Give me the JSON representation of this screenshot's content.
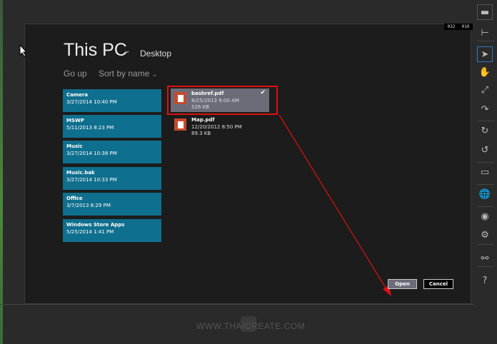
{
  "header": {
    "title": "This PC",
    "location": "Desktop",
    "go_up": "Go up",
    "sort": "Sort by name"
  },
  "counter": [
    "032",
    "010"
  ],
  "folders": [
    {
      "name": "Camera",
      "date": "3/27/2014 10:40 PM"
    },
    {
      "name": "MSWP",
      "date": "5/11/2013 8:23 PM"
    },
    {
      "name": "Music",
      "date": "3/27/2014 10:38 PM"
    },
    {
      "name": "Music.bak",
      "date": "3/27/2014 10:33 PM"
    },
    {
      "name": "Office",
      "date": "3/7/2013 8:29 PM"
    },
    {
      "name": "Windows Store Apps",
      "date": "5/25/2014 1:41 PM"
    }
  ],
  "files": [
    {
      "name": "bashref.pdf",
      "date": "8/25/2013 9:00 AM",
      "size": "526 KB",
      "selected": true
    },
    {
      "name": "Map.pdf",
      "date": "12/20/2012 8:50 PM",
      "size": "89.3 KB",
      "selected": false
    }
  ],
  "buttons": {
    "open": "Open",
    "cancel": "Cancel"
  },
  "toolbar": [
    "minimize-icon",
    "pin-icon",
    "pointer-icon",
    "hand-icon",
    "pinch-icon",
    "rotate-gesture-icon",
    "rotate-right-icon",
    "rotate-left-icon",
    "monitor-icon",
    "globe-icon",
    "camera-icon",
    "settings-icon",
    "network-icon",
    "help-icon"
  ],
  "watermark": "WWW.THAICREATE.COM",
  "colors": {
    "folder_tile": "#0f6f8e",
    "selected_file": "#6c6c78",
    "annotation": "#e01010"
  }
}
